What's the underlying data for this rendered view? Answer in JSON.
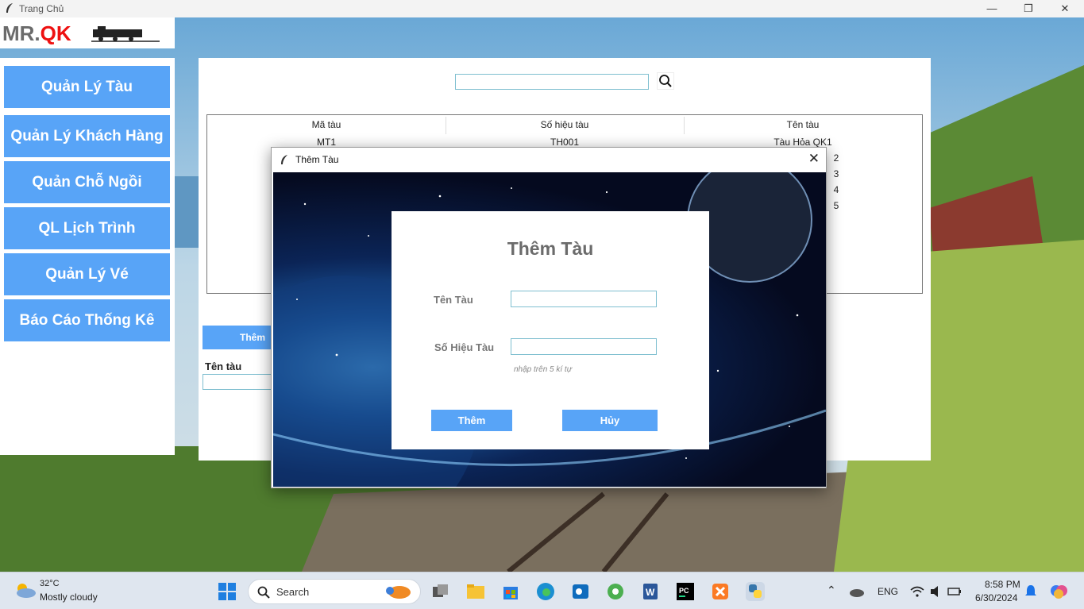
{
  "window": {
    "title": "Trang Chủ"
  },
  "logo": {
    "text_a": "MR.",
    "text_b": "QK"
  },
  "sidebar": {
    "items": [
      {
        "label": "Quản Lý Tàu"
      },
      {
        "label": "Quản Lý Khách Hàng"
      },
      {
        "label": "Quản Chỗ Ngồi"
      },
      {
        "label": "QL Lịch Trình"
      },
      {
        "label": "Quản Lý Vé"
      },
      {
        "label": "Báo Cáo Thống Kê"
      }
    ]
  },
  "main": {
    "search": {
      "value": ""
    },
    "table": {
      "columns": [
        "Mã tàu",
        "Số hiệu tàu",
        "Tên tàu"
      ],
      "visible_row": {
        "ma": "MT1",
        "so_hieu": "TH001",
        "ten": "Tàu Hỏa QK1"
      },
      "partial_right": [
        "2",
        "3",
        "4",
        "5"
      ]
    },
    "add_button": "Thêm",
    "field_label": "Tên tàu"
  },
  "dialog": {
    "title": "Thêm Tàu",
    "heading": "Thêm Tàu",
    "label_name": "Tên Tàu",
    "label_code": "Số Hiệu Tàu",
    "hint": "nhập trên 5 kí tự",
    "ok_label": "Thêm",
    "cancel_label": "Hủy"
  },
  "taskbar": {
    "weather_temp": "32°C",
    "weather_desc": "Mostly cloudy",
    "search_label": "Search",
    "lang": "ENG",
    "time": "8:58 PM",
    "date": "6/30/2024"
  },
  "colors": {
    "accent": "#58a4f7",
    "logo_red": "#e11111"
  }
}
